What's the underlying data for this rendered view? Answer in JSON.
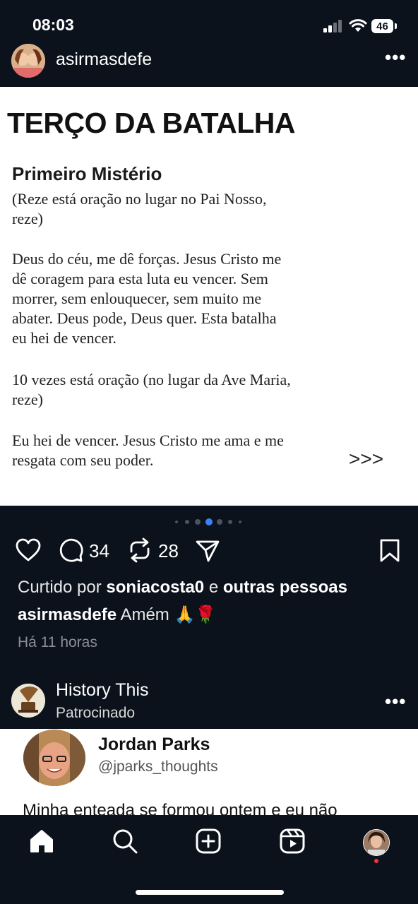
{
  "status_bar": {
    "time": "08:03",
    "battery": "46"
  },
  "post": {
    "username": "asirmasdefe",
    "image": {
      "title": "TERÇO DA BATALHA",
      "subtitle": "Primeiro Mistério",
      "lines": [
        "(Reze está oração no lugar no Pai Nosso,",
        "reze)",
        "Deus do céu, me dê forças. Jesus Cristo me",
        "dê coragem para esta luta eu vencer. Sem",
        "morrer, sem enlouquecer, sem muito me",
        "abater. Deus pode, Deus quer. Esta batalha",
        "eu hei de vencer.",
        "10 vezes está oração  (no lugar da Ave Maria,",
        "reze)",
        "Eu hei de vencer. Jesus Cristo me ama e me",
        "resgata com seu poder."
      ],
      "arrows": ">>>"
    },
    "carousel_active_index": 2,
    "comments_count": "34",
    "reposts_count": "28",
    "liked_prefix": "Curtido por",
    "liked_user": "soniacosta0",
    "liked_and": "e",
    "liked_others": "outras pessoas",
    "caption_user": "asirmasdefe",
    "caption_text": "Amém 🙏🌹",
    "time_ago": "Há 11 horas"
  },
  "sponsored": {
    "name": "History This",
    "label": "Patrocinado",
    "card": {
      "author_name": "Jordan Parks",
      "author_handle": "@jparks_thoughts",
      "text": "Minha enteada se formou ontem e eu não"
    }
  },
  "nav": {
    "items": [
      "home-icon",
      "search-icon",
      "create-icon",
      "reels-icon",
      "profile-avatar"
    ]
  },
  "colors": {
    "background": "#0c121c",
    "accent_dot": "#3a82f7",
    "notification": "#ff2d3b"
  }
}
